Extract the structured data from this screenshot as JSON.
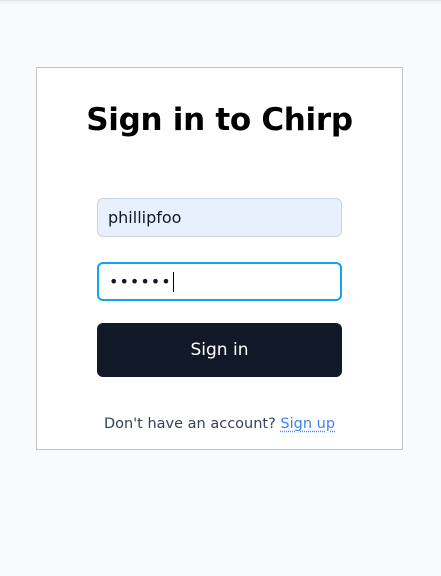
{
  "form": {
    "title": "Sign in to Chirp",
    "username_value": "phillipfoo",
    "password_value": "••••••",
    "submit_label": "Sign in",
    "footer_prompt": "Don't have an account? ",
    "signup_label": "Sign up"
  },
  "colors": {
    "button_bg": "#111827",
    "focus_border": "#0ea5e9",
    "autofill_bg": "#e8f0fe",
    "link": "#3b82f6"
  }
}
